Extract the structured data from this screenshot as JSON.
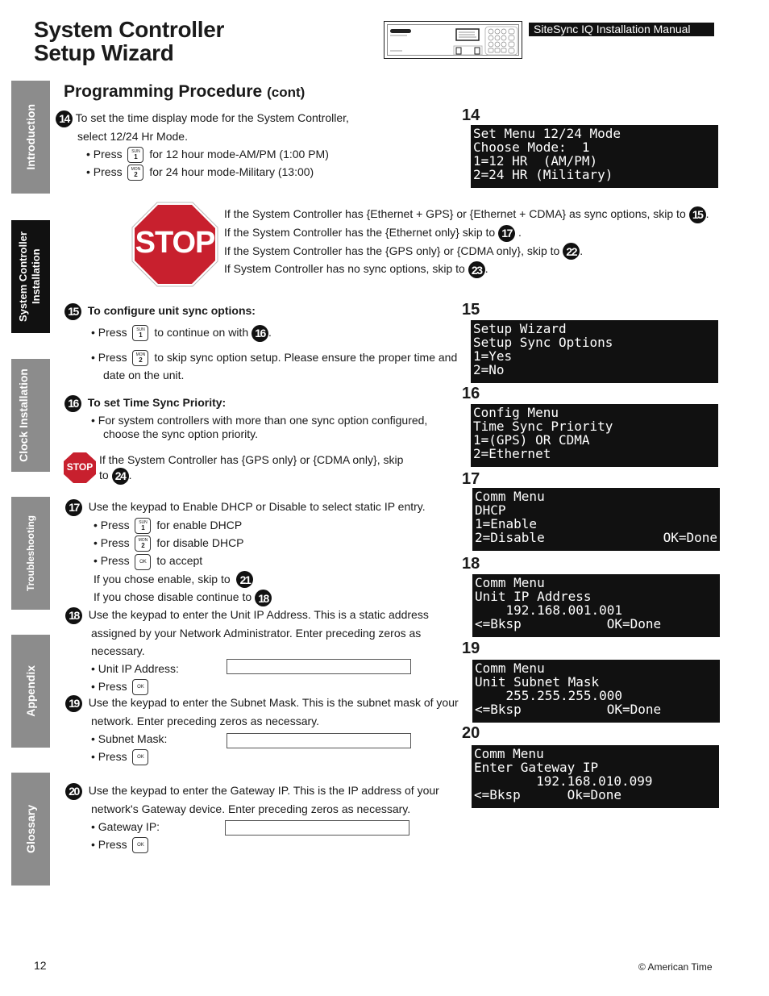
{
  "header": {
    "title_line1": "System Controller",
    "title_line2": "Setup Wizard",
    "manual_label": "SiteSync IQ Installation Manual"
  },
  "side_tabs": [
    {
      "label": "Introduction",
      "active": false
    },
    {
      "label": "System Controller Installation",
      "active": true
    },
    {
      "label": "Clock Installation",
      "active": false
    },
    {
      "label": "Troubleshooting",
      "active": false
    },
    {
      "label": "Appendix",
      "active": false
    },
    {
      "label": "Glossary",
      "active": false
    }
  ],
  "section": {
    "title": "Programming Procedure",
    "suffix": "(cont)"
  },
  "keys": {
    "sun": {
      "top": "SUN",
      "bottom": "1"
    },
    "mon": {
      "top": "MON",
      "bottom": "2"
    },
    "ok": {
      "top": "OK"
    }
  },
  "steps": {
    "s14": {
      "num": "14",
      "line1": "To set the time display mode for the System Controller,",
      "line2": "select 12/24 Hr Mode.",
      "b1_press": "• Press",
      "b1_text": "for 12 hour mode-AM/PM (1:00 PM)",
      "b2_press": "• Press",
      "b2_text": "for 24 hour mode-Military (13:00)"
    },
    "stop_main": {
      "sign": "STOP",
      "l1": "If the System Controller has {Ethernet + GPS} or {Ethernet + CDMA} as sync options, skip to",
      "l1_ref": "15",
      "l2": "If the System Controller has the {Ethernet only} skip to",
      "l2_ref": "17",
      "l3": "If the System Controller has the {GPS only} or {CDMA only}, skip to",
      "l3_ref": "22",
      "l4": "If System Controller has no sync options, skip to",
      "l4_ref": "23"
    },
    "s15": {
      "num": "15",
      "heading": "To configure unit sync options:",
      "b1_press": "• Press",
      "b1_text": "to continue on with",
      "b1_ref": "16",
      "b2_press": "• Press",
      "b2_text": "to skip sync option setup. Please ensure the proper time and",
      "b2_text2": "date on the unit."
    },
    "s16": {
      "num": "16",
      "heading": "To set Time Sync Priority:",
      "b1": "• For system controllers with more than one sync option configured,",
      "b1_cont": "choose the sync option priority."
    },
    "stop_small": {
      "sign": "STOP",
      "l1": "If the System Controller has {GPS only} or {CDMA only}, skip",
      "l2": "to",
      "ref": "24"
    },
    "s17": {
      "num": "17",
      "intro": "Use the keypad to Enable DHCP or Disable to select static IP entry.",
      "b1_press": "• Press",
      "b1_text": "for enable DHCP",
      "b2_press": "• Press",
      "b2_text": "for disable DHCP",
      "b3_press": "• Press",
      "b3_text": "to accept",
      "enable": "If you chose enable, skip to",
      "enable_ref": "21",
      "disable": "If you chose disable continue to",
      "disable_ref": "18"
    },
    "s18": {
      "num": "18",
      "l1": "Use the keypad to enter the Unit IP Address. This is a static address",
      "l2": "assigned by your Network Administrator. Enter preceding zeros as",
      "l3": "necessary.",
      "field_label": "• Unit IP Address:",
      "field_value": "",
      "press": "• Press"
    },
    "s19": {
      "num": "19",
      "l1": "Use the keypad to enter the Subnet Mask. This is the subnet mask of your",
      "l2": "network. Enter preceding zeros as necessary.",
      "field_label": "• Subnet Mask:",
      "field_value": "",
      "press": "• Press"
    },
    "s20": {
      "num": "20",
      "l1": "Use the keypad to enter the Gateway IP. This is the IP address of your",
      "l2": "network's Gateway device. Enter preceding zeros as necessary.",
      "field_label": "• Gateway IP:",
      "field_value": "",
      "press": "• Press"
    }
  },
  "screens": [
    {
      "label": "14",
      "rows": [
        [
          "Set Menu 12/24 Mode",
          ""
        ],
        [
          "Choose Mode:  1",
          ""
        ],
        [
          "1=12 HR  (AM/PM)",
          ""
        ],
        [
          "2=24 HR (Military)",
          ""
        ]
      ]
    },
    {
      "label": "15",
      "rows": [
        [
          "Setup Wizard",
          ""
        ],
        [
          "Setup Sync Options",
          ""
        ],
        [
          "1=Yes",
          ""
        ],
        [
          "2=No",
          ""
        ]
      ]
    },
    {
      "label": "16",
      "rows": [
        [
          "Config Menu",
          ""
        ],
        [
          "Time Sync Priority",
          ""
        ],
        [
          "1=(GPS) OR CDMA",
          ""
        ],
        [
          "2=Ethernet",
          ""
        ]
      ]
    },
    {
      "label": "17",
      "rows": [
        [
          "Comm Menu",
          ""
        ],
        [
          "DHCP",
          ""
        ],
        [
          "1=Enable",
          ""
        ],
        [
          "2=Disable",
          "OK=Done"
        ]
      ]
    },
    {
      "label": "18",
      "rows": [
        [
          "Comm Menu",
          ""
        ],
        [
          "Unit IP Address",
          ""
        ],
        [
          "    192.168.001.001",
          ""
        ],
        [
          "<=Bksp           OK=Done",
          ""
        ]
      ]
    },
    {
      "label": "19",
      "rows": [
        [
          "Comm Menu",
          ""
        ],
        [
          "Unit Subnet Mask",
          ""
        ],
        [
          "    255.255.255.000",
          ""
        ],
        [
          "<=Bksp           OK=Done",
          ""
        ]
      ]
    },
    {
      "label": "20",
      "rows": [
        [
          "Comm Menu",
          ""
        ],
        [
          "Enter Gateway IP",
          ""
        ],
        [
          "        192.168.010.099",
          ""
        ],
        [
          "<=Bksp      Ok=Done",
          ""
        ]
      ]
    }
  ],
  "footer": {
    "page_number": "12",
    "copyright": "© American Time"
  },
  "colors": {
    "stop_red": "#c8202e",
    "tab_gray": "#8c8c8c",
    "tab_active": "#111111",
    "lcd_bg": "#111111"
  }
}
